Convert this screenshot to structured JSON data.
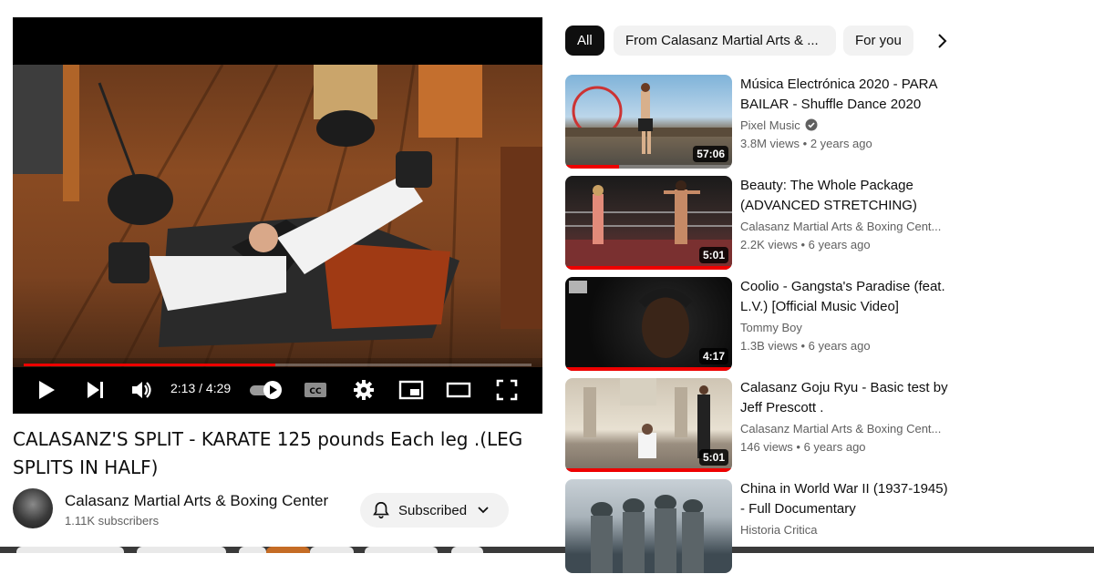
{
  "player": {
    "time": "2:13 / 4:29",
    "progress_fraction": 0.495,
    "icons": [
      "play-icon",
      "next-icon",
      "volume-icon",
      "autoplay-toggle",
      "captions-icon",
      "settings-icon",
      "miniplayer-icon",
      "theater-icon",
      "fullscreen-icon"
    ]
  },
  "video": {
    "title": "CALASANZ'S SPLIT - KARATE 125 pounds Each leg .(LEG SPLITS IN HALF)",
    "channel": "Calasanz Martial Arts & Boxing Center",
    "subscribers": "1.11K subscribers",
    "subscribe_label": "Subscribed"
  },
  "chips": {
    "all": "All",
    "from_channel": "From Calasanz Martial Arts & ...",
    "for_you": "For you"
  },
  "recommendations": [
    {
      "title": "Música Electrónica 2020 - PARA BAILAR - Shuffle Dance 2020",
      "channel": "Pixel Music",
      "verified": true,
      "views": "3.8M views",
      "age": "2 years ago",
      "duration": "57:06",
      "watched_fraction": 0.32
    },
    {
      "title": "Beauty: The Whole Package (ADVANCED STRETCHING)",
      "channel": "Calasanz Martial Arts & Boxing Cent...",
      "verified": false,
      "views": "2.2K views",
      "age": "6 years ago",
      "duration": "5:01",
      "watched_fraction": 1.0
    },
    {
      "title": "Coolio - Gangsta's Paradise (feat. L.V.) [Official Music Video]",
      "channel": "Tommy Boy",
      "verified": false,
      "views": "1.3B views",
      "age": "6 years ago",
      "duration": "4:17",
      "watched_fraction": 1.0
    },
    {
      "title": "Calasanz Goju Ryu - Basic test by Jeff Prescott .",
      "channel": "Calasanz Martial Arts & Boxing Cent...",
      "verified": false,
      "views": "146 views",
      "age": "6 years ago",
      "duration": "5:01",
      "watched_fraction": 1.0
    },
    {
      "title": "China in World War II (1937-1945) - Full Documentary",
      "channel": "Historia Critica",
      "verified": false,
      "views": "",
      "age": "",
      "duration": "",
      "watched_fraction": 0
    }
  ],
  "colors": {
    "accent": "#ff0000",
    "chip_active": "#0f0f0f",
    "chip_bg": "#f2f2f2",
    "secondary_text": "#606060"
  }
}
